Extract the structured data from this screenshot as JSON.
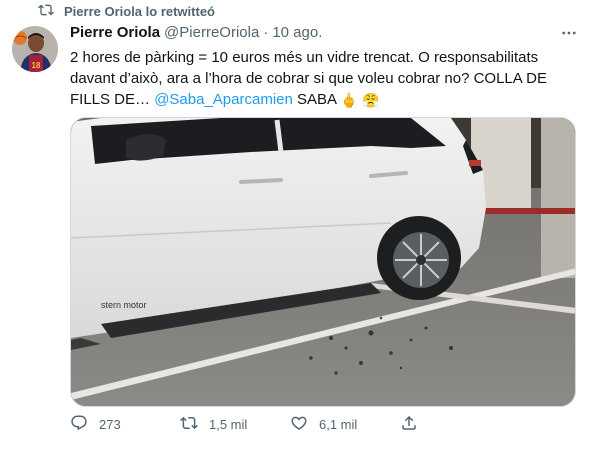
{
  "retweet": {
    "icon": "retweet-icon",
    "text": "Pierre Oriola lo retwitteó"
  },
  "author": {
    "avatar_icon": "player-avatar",
    "avatar_jersey_number": "18",
    "name": "Pierre Oriola",
    "handle": "@PierreOriola",
    "separator": "·",
    "date": "10 ago."
  },
  "more_icon": "more-horizontal-icon",
  "tweet": {
    "text_part1": "2 hores de pàrking = 10 euros més un vidre trencat. O responsabilitats davant d’això, ara a l’hora de cobrar si que voleu cobrar no? COLLA DE FILLS DE… ",
    "mention": "@Saba_Aparcamien",
    "text_part2": " SABA ",
    "emoji1": "🖕",
    "emoji2": "😤"
  },
  "media": {
    "description_icon": "photo",
    "car_brand_text": "stern motor"
  },
  "actions": {
    "reply": {
      "icon": "reply-icon",
      "count": "273"
    },
    "retweet": {
      "icon": "retweet-icon",
      "count": "1,5 mil"
    },
    "like": {
      "icon": "heart-icon",
      "count": "6,1 mil"
    },
    "share": {
      "icon": "share-icon"
    }
  },
  "colors": {
    "accent": "#1d9bf0",
    "text_primary": "#0f1419",
    "text_secondary": "#536471"
  }
}
